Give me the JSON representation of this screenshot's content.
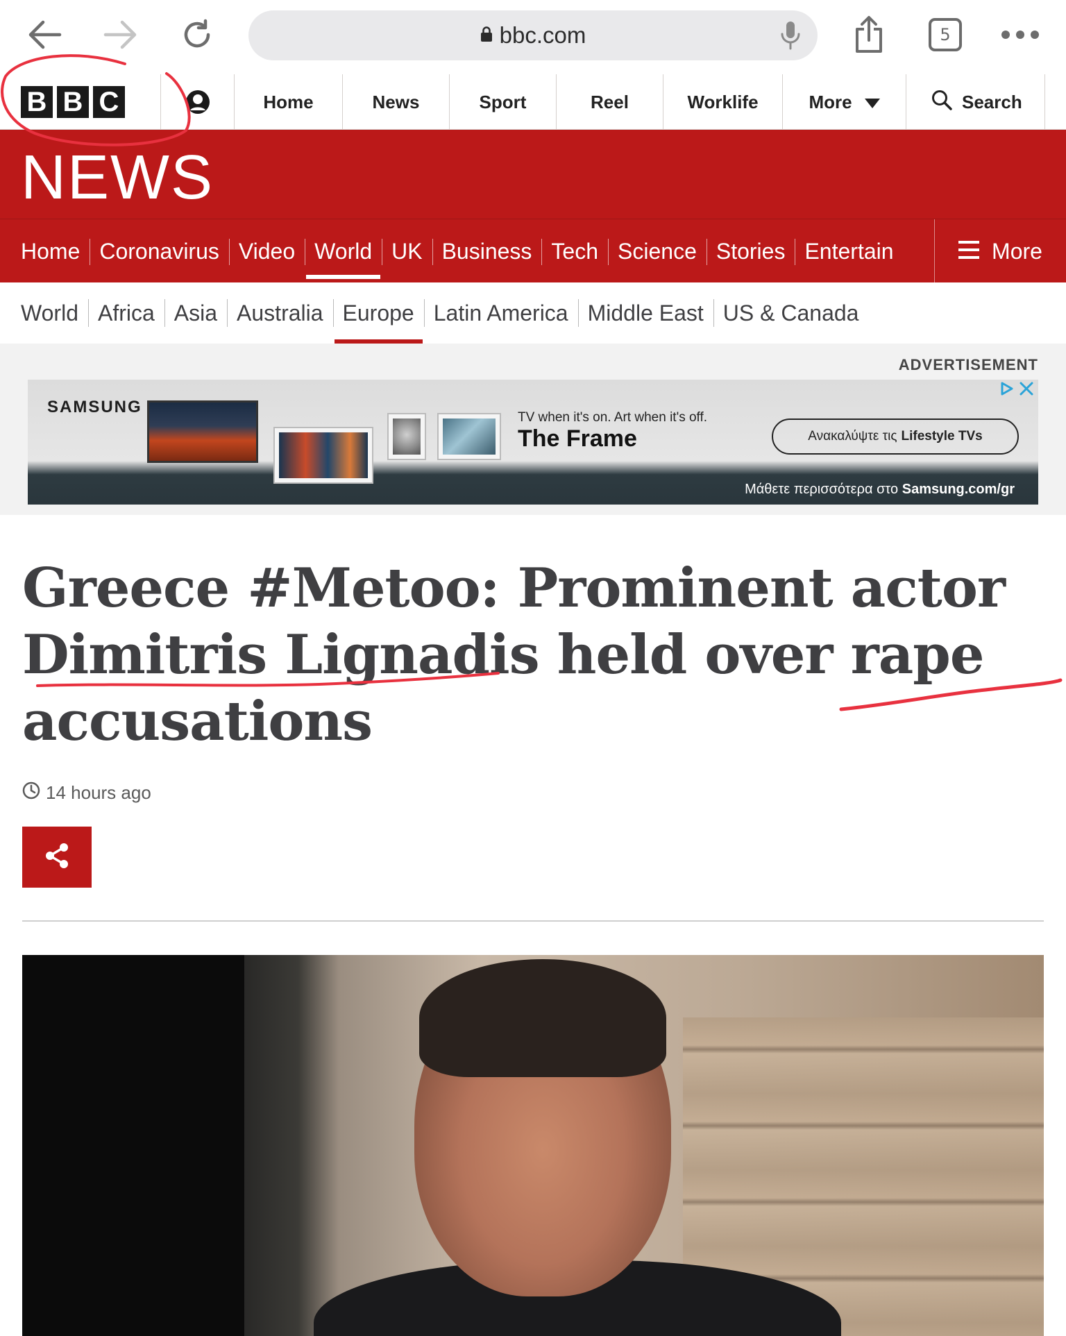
{
  "browser": {
    "url": "bbc.com",
    "tab_count": "5"
  },
  "global_nav": {
    "logo_letters": [
      "B",
      "B",
      "C"
    ],
    "links": [
      "Home",
      "News",
      "Sport",
      "Reel",
      "Worklife"
    ],
    "more_label": "More",
    "search_label": "Search"
  },
  "news_header": {
    "brand": "NEWS"
  },
  "section_nav": {
    "items": [
      "Home",
      "Coronavirus",
      "Video",
      "World",
      "UK",
      "Business",
      "Tech",
      "Science",
      "Stories",
      "Entertain"
    ],
    "active": "World",
    "more_label": "More"
  },
  "sub_nav": {
    "items": [
      "World",
      "Africa",
      "Asia",
      "Australia",
      "Europe",
      "Latin America",
      "Middle East",
      "US & Canada"
    ],
    "active": "Europe"
  },
  "ad": {
    "label": "ADVERTISEMENT",
    "brand": "SAMSUNG",
    "tagline_small": "TV when it's on.  Art when it's off.",
    "tagline_big": "The Frame",
    "cta_text": "Ανακαλύψτε τις",
    "cta_bold": "Lifestyle TVs",
    "footer_text": "Μάθετε περισσότερα στο",
    "footer_bold": "Samsung.com/gr"
  },
  "article": {
    "headline": "Greece #Metoo: Prominent actor Dimitris Lignadis held over rape accusations",
    "timestamp": "14 hours ago"
  },
  "colors": {
    "bbc_red": "#bb1919",
    "annotation_red": "#e8313f",
    "text": "#3f3f42"
  },
  "icons": [
    "back-arrow-icon",
    "forward-arrow-icon",
    "reload-icon",
    "lock-icon",
    "microphone-icon",
    "share-upload-icon",
    "more-dots-icon",
    "account-icon",
    "caret-down-icon",
    "search-icon",
    "hamburger-icon",
    "clock-icon",
    "share-icon"
  ]
}
